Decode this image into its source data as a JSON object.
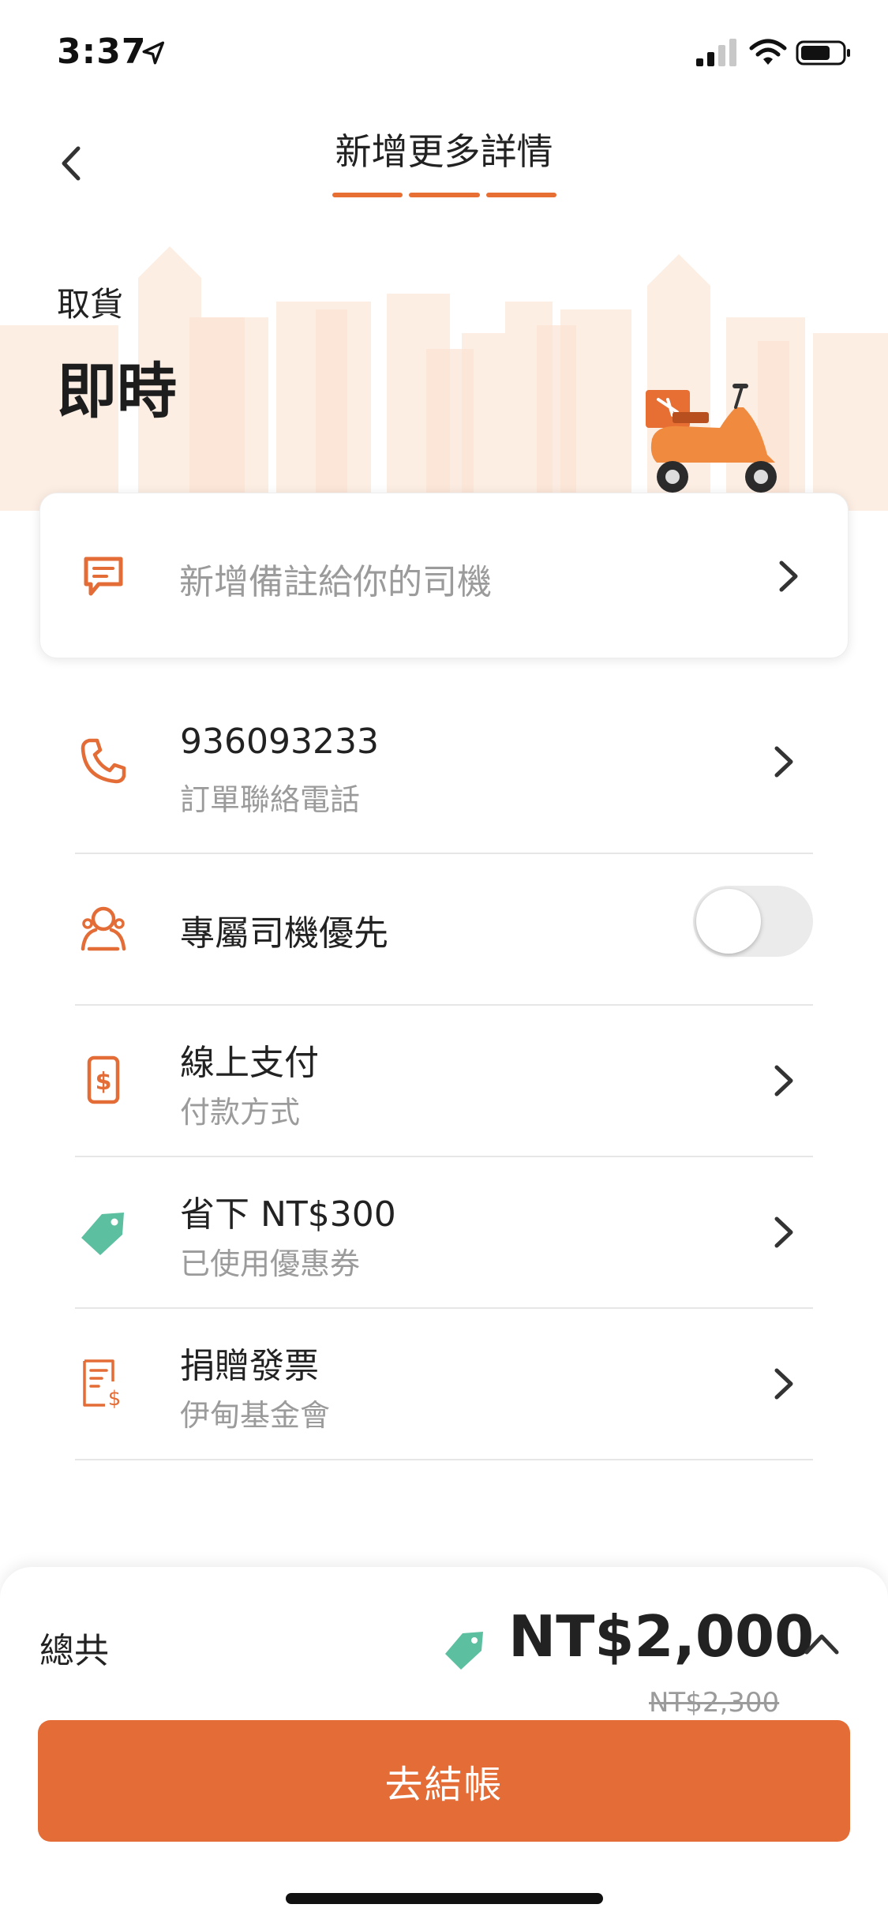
{
  "status_bar": {
    "time": "3:37"
  },
  "header": {
    "title": "新增更多詳情",
    "progress_steps": 3,
    "progress_completed": 3
  },
  "hero": {
    "label": "取貨",
    "value": "即時"
  },
  "note_card": {
    "placeholder": "新增備註給你的司機"
  },
  "rows": [
    {
      "title": "936093233",
      "subtitle": "訂單聯絡電話",
      "icon": "phone-icon"
    },
    {
      "title": "專屬司機優先",
      "toggle_on": false,
      "icon": "driver-icon"
    },
    {
      "title": "線上支付",
      "subtitle": "付款方式",
      "icon": "payment-icon"
    },
    {
      "title": "省下 NT$300",
      "subtitle": "已使用優惠券",
      "icon": "tag-icon"
    },
    {
      "title": "捐贈發票",
      "subtitle": "伊甸基金會",
      "icon": "receipt-icon"
    }
  ],
  "footer": {
    "total_label": "總共",
    "total_price": "NT$2,000",
    "original_price": "NT$2,300",
    "checkout_label": "去結帳"
  },
  "colors": {
    "accent": "#e46d37",
    "tag": "#5cbfa0",
    "muted": "#9b9b9b"
  }
}
